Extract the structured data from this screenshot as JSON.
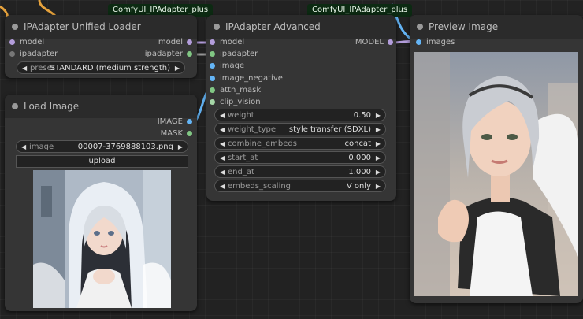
{
  "badges": {
    "loader_badge": "ComfyUI_IPAdapter_plus",
    "advanced_badge": "ComfyUI_IPAdapter_plus"
  },
  "loader": {
    "title": "IPAdapter Unified Loader",
    "inputs": [
      "model",
      "ipadapter"
    ],
    "outputs": [
      "model",
      "ipadapter"
    ],
    "preset_label": "preset",
    "preset_value": "STANDARD (medium strength)"
  },
  "load_image": {
    "title": "Load Image",
    "outputs": [
      "IMAGE",
      "MASK"
    ],
    "image_label": "image",
    "image_value": "00007-3769888103.png",
    "upload_label": "upload"
  },
  "advanced": {
    "title": "IPAdapter Advanced",
    "inputs": [
      "model",
      "ipadapter",
      "image",
      "image_negative",
      "attn_mask",
      "clip_vision"
    ],
    "output": "MODEL",
    "widgets": [
      {
        "label": "weight",
        "value": "0.50"
      },
      {
        "label": "weight_type",
        "value": "style transfer (SDXL)"
      },
      {
        "label": "combine_embeds",
        "value": "concat"
      },
      {
        "label": "start_at",
        "value": "0.000"
      },
      {
        "label": "end_at",
        "value": "1.000"
      },
      {
        "label": "embeds_scaling",
        "value": "V only"
      }
    ]
  },
  "preview": {
    "title": "Preview Image",
    "input": "images"
  },
  "colors": {
    "model_pin": "#b39ddb",
    "ipadapter_pin": "#3b3b3b",
    "image_pin": "#64b5f6",
    "mask_pin": "#81c784",
    "wire_blue": "#64b5f6",
    "wire_orange": "#e6a23c"
  }
}
